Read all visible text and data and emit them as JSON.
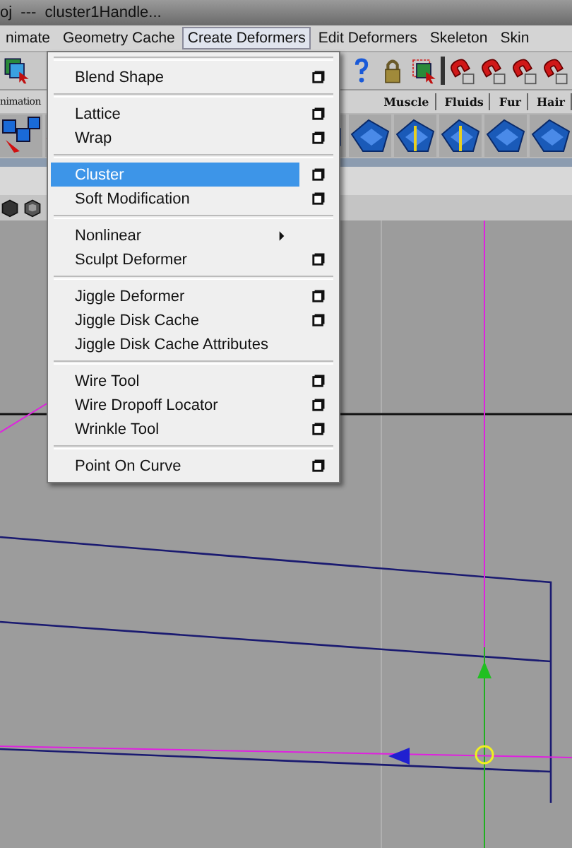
{
  "title_bar": {
    "title": "oj  ---  cluster1Handle..."
  },
  "menu_bar": [
    {
      "label": "nimate",
      "selected": false
    },
    {
      "label": "Geometry Cache",
      "selected": false
    },
    {
      "label": "Create Deformers",
      "selected": true
    },
    {
      "label": "Edit Deformers",
      "selected": false
    },
    {
      "label": "Skeleton",
      "selected": false
    },
    {
      "label": "Skin",
      "selected": false
    }
  ],
  "shelf_tabs": [
    {
      "label": "nimation",
      "selected": false
    },
    {
      "label": "Muscle",
      "selected": false
    },
    {
      "label": "Fluids",
      "selected": false
    },
    {
      "label": "Fur",
      "selected": false
    },
    {
      "label": "Hair",
      "selected": false
    }
  ],
  "menu": {
    "sections": [
      [
        {
          "label": "Blend Shape",
          "option_box": true,
          "submenu": false,
          "selected": false
        }
      ],
      [
        {
          "label": "Lattice",
          "option_box": true,
          "submenu": false,
          "selected": false
        },
        {
          "label": "Wrap",
          "option_box": true,
          "submenu": false,
          "selected": false
        }
      ],
      [
        {
          "label": "Cluster",
          "option_box": true,
          "submenu": false,
          "selected": true
        },
        {
          "label": "Soft Modification",
          "option_box": true,
          "submenu": false,
          "selected": false
        }
      ],
      [
        {
          "label": "Nonlinear",
          "option_box": false,
          "submenu": true,
          "selected": false
        },
        {
          "label": "Sculpt Deformer",
          "option_box": true,
          "submenu": false,
          "selected": false
        }
      ],
      [
        {
          "label": "Jiggle Deformer",
          "option_box": true,
          "submenu": false,
          "selected": false
        },
        {
          "label": "Jiggle Disk Cache",
          "option_box": true,
          "submenu": false,
          "selected": false
        },
        {
          "label": "Jiggle Disk Cache Attributes",
          "option_box": false,
          "submenu": false,
          "selected": false
        }
      ],
      [
        {
          "label": "Wire Tool",
          "option_box": true,
          "submenu": false,
          "selected": false
        },
        {
          "label": "Wire Dropoff Locator",
          "option_box": true,
          "submenu": false,
          "selected": false
        },
        {
          "label": "Wrinkle Tool",
          "option_box": true,
          "submenu": false,
          "selected": false
        }
      ],
      [
        {
          "label": "Point On Curve",
          "option_box": true,
          "submenu": false,
          "selected": false
        }
      ]
    ]
  }
}
